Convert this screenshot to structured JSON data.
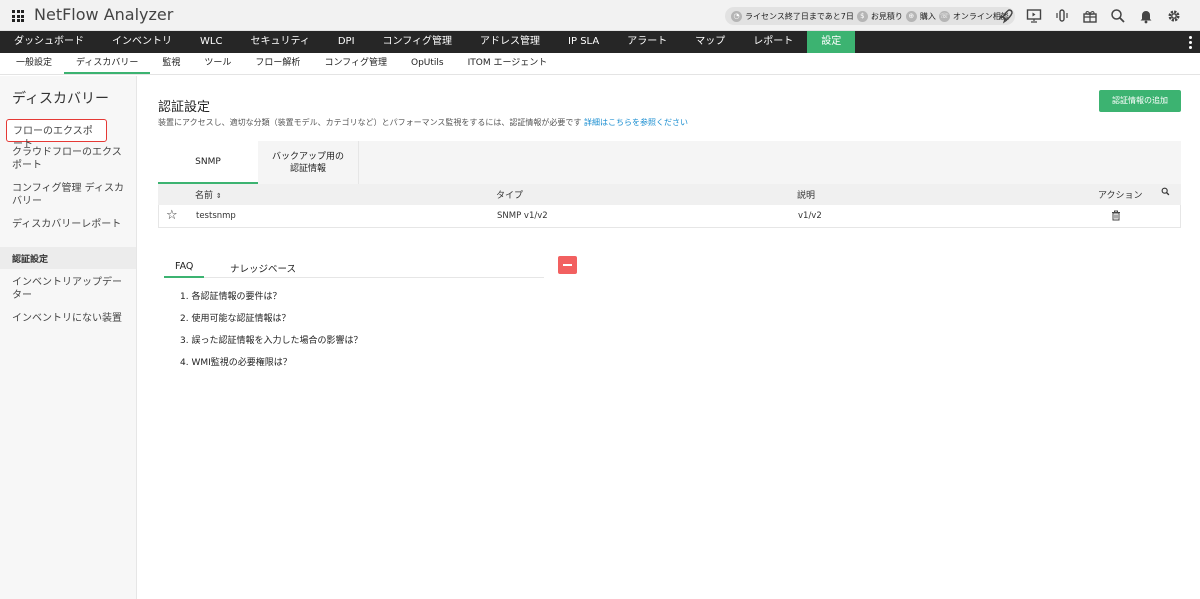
{
  "app": {
    "title": "NetFlow Analyzer"
  },
  "header": {
    "license": {
      "icon": "license-icon",
      "label": "ライセンス終了日まであと7日"
    },
    "quote": {
      "icon": "dollar-icon",
      "label": "お見積り"
    },
    "buy": {
      "icon": "cart-icon",
      "label": "購入"
    },
    "consult": {
      "icon": "phone-icon",
      "label": "オンライン相談"
    },
    "icons": [
      "rocket-icon",
      "presentation-icon",
      "remote-icon",
      "gift-icon",
      "search-icon",
      "bell-icon",
      "gear-icon"
    ]
  },
  "mainnav": {
    "items": [
      {
        "label": "ダッシュボード"
      },
      {
        "label": "インベントリ"
      },
      {
        "label": "WLC"
      },
      {
        "label": "セキュリティ"
      },
      {
        "label": "DPI"
      },
      {
        "label": "コンフィグ管理"
      },
      {
        "label": "アドレス管理"
      },
      {
        "label": "IP SLA"
      },
      {
        "label": "アラート"
      },
      {
        "label": "マップ"
      },
      {
        "label": "レポート"
      },
      {
        "label": "設定"
      }
    ],
    "active_index": 11
  },
  "subnav": {
    "items": [
      {
        "label": "一般設定"
      },
      {
        "label": "ディスカバリー"
      },
      {
        "label": "監視"
      },
      {
        "label": "ツール"
      },
      {
        "label": "フロー解析"
      },
      {
        "label": "コンフィグ管理"
      },
      {
        "label": "OpUtils"
      },
      {
        "label": "ITOM エージェント"
      }
    ],
    "active_index": 1
  },
  "sidebar": {
    "title": "ディスカバリー",
    "items": [
      {
        "label": "フローのエクスポート"
      },
      {
        "label": "クラウドフローのエクスポート"
      },
      {
        "label": "コンフィグ管理 ディスカバリー"
      },
      {
        "label": "ディスカバリーレポート"
      }
    ],
    "section": {
      "label": "認証設定"
    },
    "items2": [
      {
        "label": "インベントリアップデーター"
      },
      {
        "label": "インベントリにない装置"
      }
    ]
  },
  "main": {
    "title": "認証設定",
    "description": "装置にアクセスし、適切な分類（装置モデル、カテゴリなど）とパフォーマンス監視をするには、認証情報が必要です",
    "link": "詳細はこちらを参照ください",
    "add_button": "認証情報の追加",
    "tabs": [
      {
        "label": "SNMP"
      },
      {
        "label": "バックアップ用の認証情報"
      }
    ],
    "table": {
      "columns": {
        "name": "名前",
        "type": "タイプ",
        "description": "説明",
        "action": "アクション"
      },
      "sort_indicator": "⇕",
      "rows": [
        {
          "name": "testsnmp",
          "type": "SNMP v1/v2",
          "description": "v1/v2"
        }
      ]
    },
    "faq": {
      "tabs": [
        {
          "label": "FAQ"
        },
        {
          "label": "ナレッジベース"
        }
      ],
      "items": [
        "1. 各認証情報の要件は？",
        "2. 使用可能な認証情報は？",
        "3. 誤った認証情報を入力した場合の影響は？",
        "4. WMI監視の必要権限は？"
      ]
    }
  },
  "colors": {
    "accent": "#3cb371",
    "nav_bg": "#262626",
    "link": "#1a8ed1",
    "danger": "#f26060",
    "highlight_border": "#e53935"
  }
}
